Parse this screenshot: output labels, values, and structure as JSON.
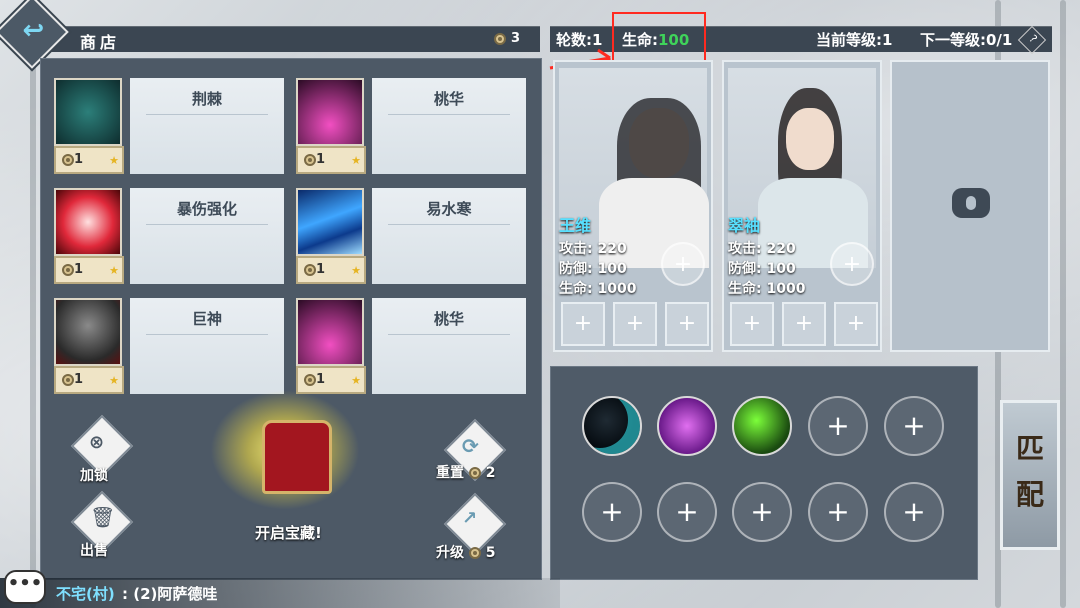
{
  "shop": {
    "title": "商店",
    "currency": "3",
    "items": [
      {
        "name": "荆棘",
        "price": "1"
      },
      {
        "name": "桃华",
        "price": "1"
      },
      {
        "name": "暴伤强化",
        "price": "1"
      },
      {
        "name": "易水寒",
        "price": "1"
      },
      {
        "name": "巨神",
        "price": "1"
      },
      {
        "name": "桃华",
        "price": "1"
      }
    ],
    "lock_label": "加锁",
    "sell_label": "出售",
    "treasure_label": "开启宝藏!",
    "reset_label": "重置",
    "reset_cost": "2",
    "upgrade_label": "升级",
    "upgrade_cost": "5"
  },
  "status": {
    "rounds": "轮数:1",
    "life_label": "生命:",
    "life_value": "100",
    "current_level": "当前等级:1",
    "next_level": "下一等级:0/1",
    "help": "?"
  },
  "heroes": [
    {
      "name": "王维",
      "attack": "攻击: 220",
      "defense": "防御: 100",
      "hp": "生命: 1000"
    },
    {
      "name": "翠袖",
      "attack": "攻击: 220",
      "defense": "防御: 100",
      "hp": "生命: 1000"
    }
  ],
  "plus": "+",
  "match_label_1": "匹",
  "match_label_2": "配",
  "chat": {
    "icon": "•••",
    "speaker": "不宅(村)",
    "message": ": (2)阿萨德哇"
  },
  "colors": {
    "life_value": "#3fd35a",
    "hero_name": "#58e0ff",
    "highlight_box": "#ff2a20"
  }
}
